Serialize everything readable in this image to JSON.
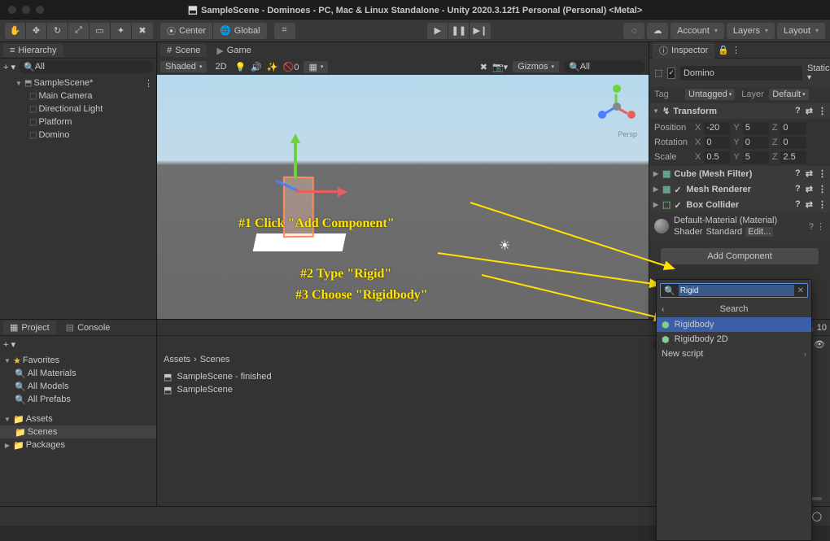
{
  "window": {
    "title": "SampleScene - Dominoes - PC, Mac & Linux Standalone - Unity 2020.3.12f1 Personal (Personal) <Metal>"
  },
  "toolbar": {
    "pivot": "Center",
    "space": "Global",
    "account": "Account",
    "layers": "Layers",
    "layout": "Layout"
  },
  "hierarchy": {
    "title": "Hierarchy",
    "search_placeholder": "All",
    "scene": "SampleScene*",
    "items": [
      "Main Camera",
      "Directional Light",
      "Platform",
      "Domino"
    ]
  },
  "scene": {
    "tab_scene": "Scene",
    "tab_game": "Game",
    "shading": "Shaded",
    "mode_2d": "2D",
    "gizmos": "Gizmos",
    "search_placeholder": "All",
    "persp": "Persp"
  },
  "annotations": {
    "a1": "#1 Click \"Add Component\"",
    "a2": "#2 Type \"Rigid\"",
    "a3": "#3 Choose \"Rigidbody\""
  },
  "inspector": {
    "title": "Inspector",
    "obj_name": "Domino",
    "static": "Static",
    "tag_label": "Tag",
    "tag_value": "Untagged",
    "layer_label": "Layer",
    "layer_value": "Default",
    "transform": {
      "title": "Transform",
      "position": {
        "label": "Position",
        "x": "-20",
        "y": "5",
        "z": "0"
      },
      "rotation": {
        "label": "Rotation",
        "x": "0",
        "y": "0",
        "z": "0"
      },
      "scale": {
        "label": "Scale",
        "x": "0.5",
        "y": "5",
        "z": "2.5"
      }
    },
    "mesh_filter": "Cube (Mesh Filter)",
    "mesh_renderer": "Mesh Renderer",
    "box_collider": "Box Collider",
    "material": {
      "name": "Default-Material (Material)",
      "shader_label": "Shader",
      "shader_value": "Standard",
      "edit": "Edit..."
    },
    "add_component": "Add Component"
  },
  "popup": {
    "search_value": "Rigid",
    "header": "Search",
    "items": [
      "Rigidbody",
      "Rigidbody 2D",
      "New script"
    ]
  },
  "project": {
    "tab_project": "Project",
    "tab_console": "Console",
    "favorites": "Favorites",
    "fav_items": [
      "All Materials",
      "All Models",
      "All Prefabs"
    ],
    "assets": "Assets",
    "assets_items": [
      "Scenes"
    ],
    "packages": "Packages"
  },
  "content": {
    "breadcrumb": [
      "Assets",
      "Scenes"
    ],
    "hidden_count": "10",
    "items": [
      "SampleScene - finished",
      "SampleScene"
    ]
  }
}
